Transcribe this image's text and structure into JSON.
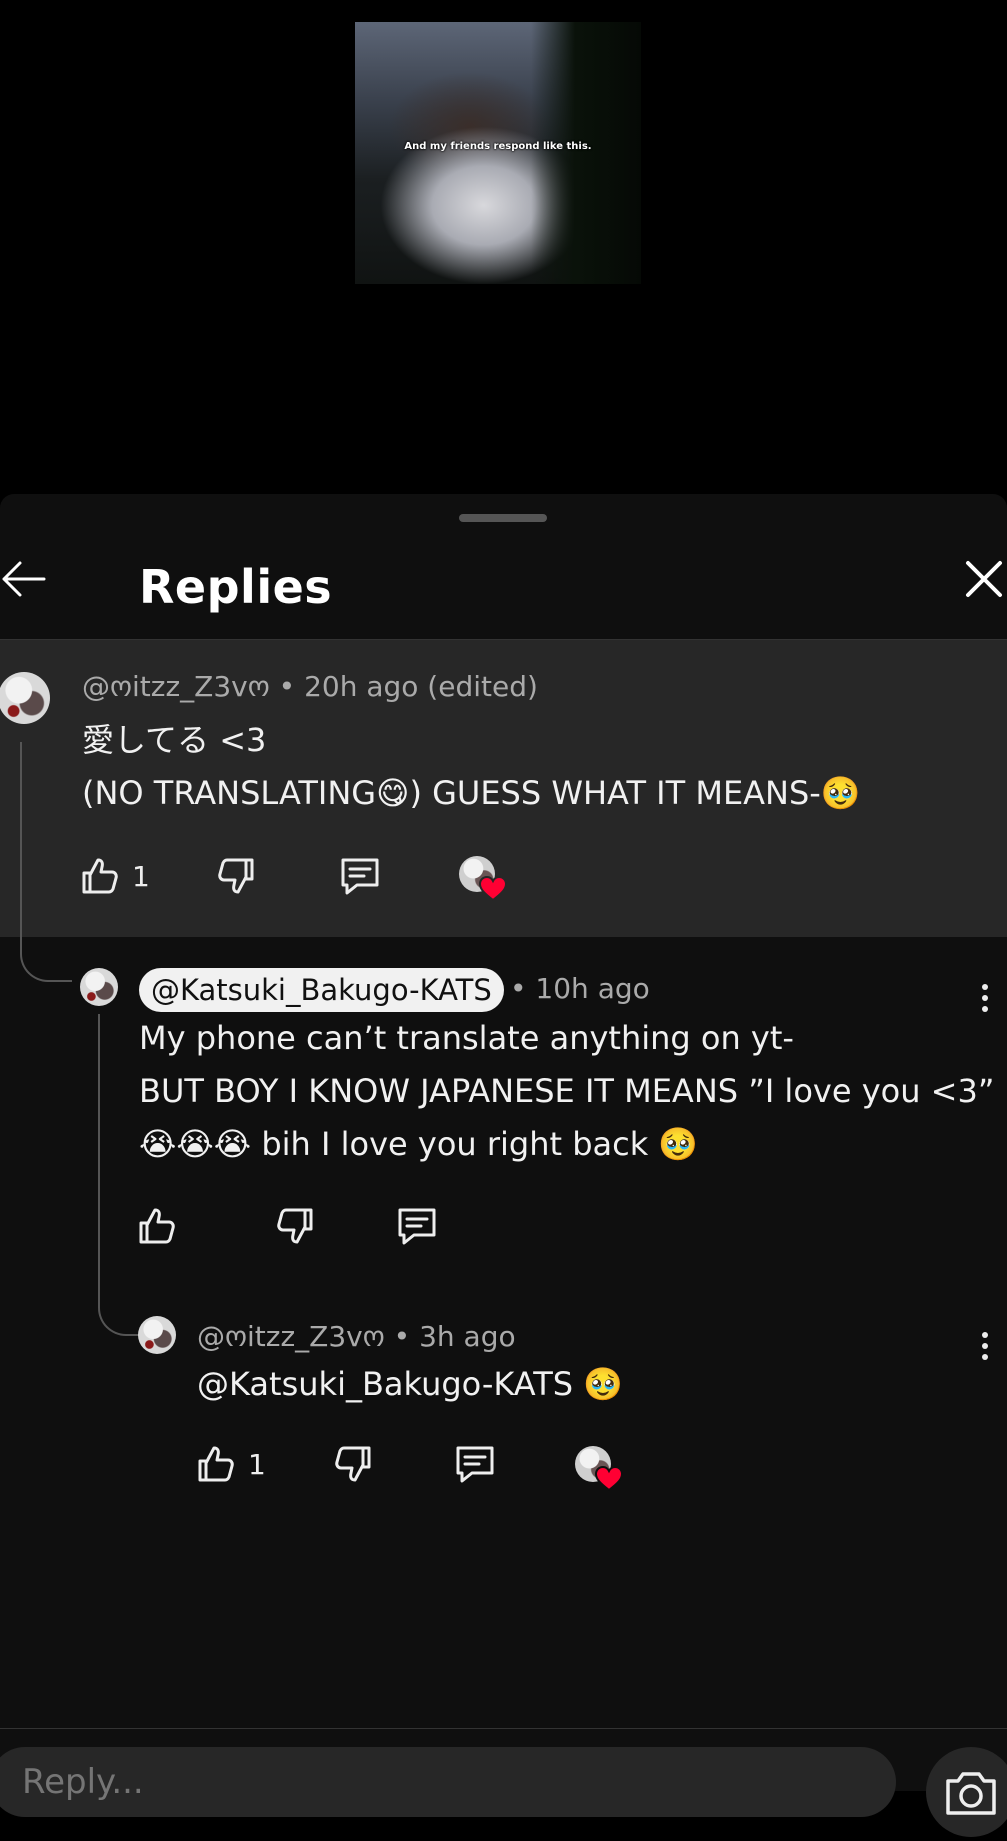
{
  "video": {
    "caption": "And my friends respond like this."
  },
  "header": {
    "title": "Replies"
  },
  "comments": [
    {
      "author": "@ოitzz_Z3vო",
      "time": "• 20h ago (edited)",
      "lines": [
        "愛してる <3",
        "(NO TRANSLATING😋) GUESS WHAT IT MEANS-🥹"
      ],
      "likes": "1",
      "creator_heart": true
    },
    {
      "author": "@Katsuki_Bakugo-KATS",
      "time": "• 10h ago",
      "lines": [
        "My phone can’t  translate anything on yt-",
        "BUT BOY I KNOW JAPANESE IT MEANS ”I love you <3”",
        "😭😭😭 bih I love you right back 🥹"
      ],
      "likes": "",
      "creator_heart": false
    },
    {
      "author": "@ოitzz_Z3vო",
      "time": "• 3h ago",
      "lines": [
        "@Katsuki_Bakugo-KATS 🥹"
      ],
      "likes": "1",
      "creator_heart": true
    }
  ],
  "reply_box": {
    "placeholder": "Reply..."
  },
  "icons": [
    "back-arrow-icon",
    "close-icon",
    "thumbs-up-icon",
    "thumbs-down-icon",
    "reply-icon",
    "heart-icon",
    "more-vert-icon",
    "camera-icon"
  ],
  "colors": {
    "sheet_bg": "#0f0f0f",
    "highlight_bg": "#272727",
    "heart": "#ff0033"
  }
}
